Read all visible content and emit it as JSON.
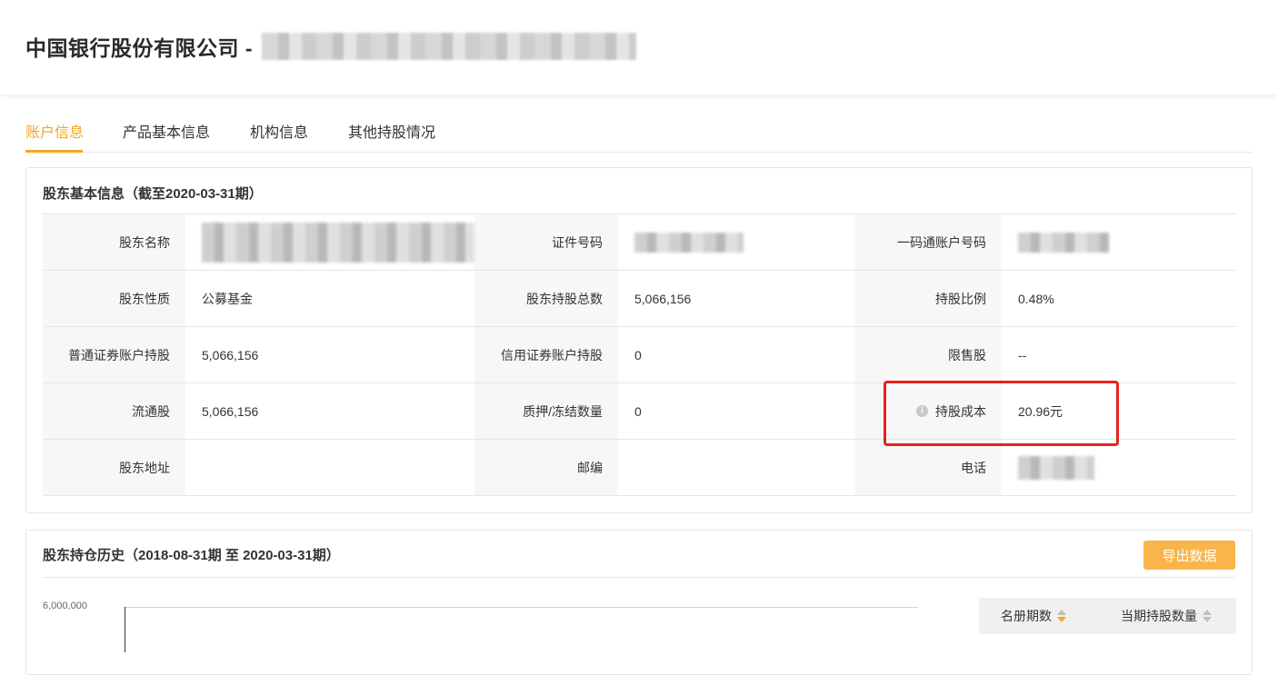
{
  "header": {
    "company_title": "中国银行股份有限公司 -"
  },
  "tabs": [
    {
      "label": "账户信息",
      "active": true
    },
    {
      "label": "产品基本信息",
      "active": false
    },
    {
      "label": "机构信息",
      "active": false
    },
    {
      "label": "其他持股情况",
      "active": false
    }
  ],
  "shareholder_info": {
    "title": "股东基本信息（截至2020-03-31期）",
    "rows": [
      [
        {
          "label": "股东名称",
          "value": ""
        },
        {
          "label": "证件号码",
          "value": ""
        },
        {
          "label": "一码通账户号码",
          "value": ""
        }
      ],
      [
        {
          "label": "股东性质",
          "value": "公募基金"
        },
        {
          "label": "股东持股总数",
          "value": "5,066,156"
        },
        {
          "label": "持股比例",
          "value": "0.48%"
        }
      ],
      [
        {
          "label": "普通证券账户持股",
          "value": "5,066,156"
        },
        {
          "label": "信用证券账户持股",
          "value": "0"
        },
        {
          "label": "限售股",
          "value": "--"
        }
      ],
      [
        {
          "label": "流通股",
          "value": "5,066,156"
        },
        {
          "label": "质押/冻结数量",
          "value": "0"
        },
        {
          "label": "持股成本",
          "value": "20.96元"
        }
      ],
      [
        {
          "label": "股东地址",
          "value": ""
        },
        {
          "label": "邮编",
          "value": ""
        },
        {
          "label": "电话",
          "value": ""
        }
      ]
    ]
  },
  "holding_history": {
    "title": "股东持仓历史（2018-08-31期 至 2020-03-31期）",
    "export_label": "导出数据",
    "y_tick_top": "6,000,000",
    "table_headers": [
      "名册期数",
      "当期持股数量"
    ]
  },
  "colors": {
    "accent": "#f5a623",
    "highlight": "#e8231b",
    "button": "#f8b54a"
  }
}
